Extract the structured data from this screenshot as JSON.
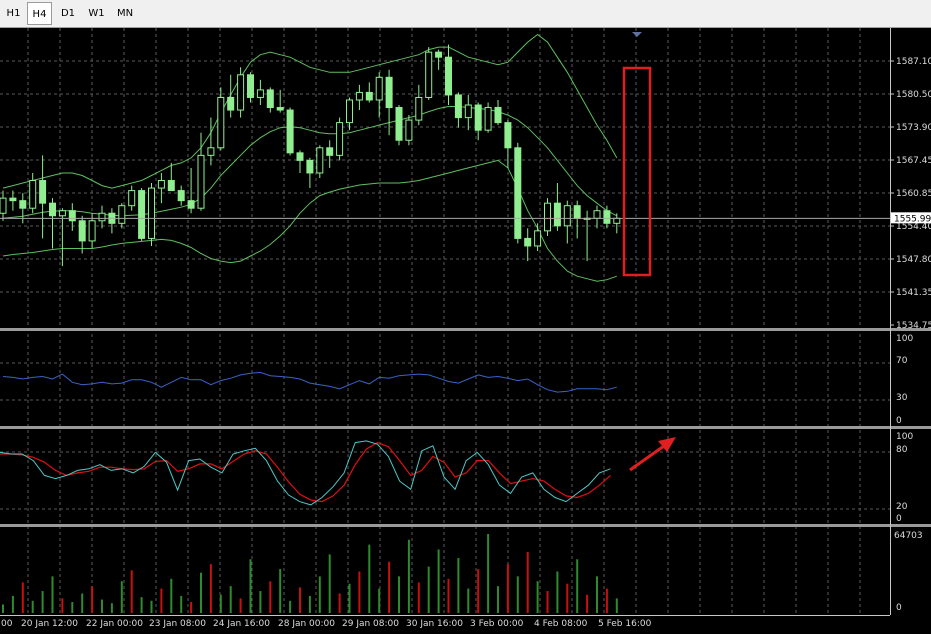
{
  "toolbar": {
    "timeframes": [
      {
        "label": "H1",
        "active": false
      },
      {
        "label": "H4",
        "active": true
      },
      {
        "label": "D1",
        "active": false
      },
      {
        "label": "W1",
        "active": false
      },
      {
        "label": "MN",
        "active": false
      }
    ]
  },
  "colors": {
    "background": "#000000",
    "grid": "#5a5a5a",
    "candle": "#90ee90",
    "bands": "#5fbf5f",
    "rsi": "#3a63c8",
    "stoch_main": "#4fc8c8",
    "stoch_signal": "#e01010",
    "vol_up": "#2e8b2e",
    "vol_down": "#c81010",
    "annotation": "#e02020"
  },
  "price_axis": {
    "labels": [
      "1587.10",
      "1580.50",
      "1573.90",
      "1567.45",
      "1560.85",
      "1554.40",
      "1547.80",
      "1541.35",
      "1534.75"
    ],
    "current_price": "1555.99"
  },
  "rsi_axis": {
    "labels": [
      "100",
      "70",
      "30",
      "0"
    ]
  },
  "stoch_axis": {
    "labels": [
      "100",
      "80",
      "20",
      "0"
    ]
  },
  "volume_axis": {
    "labels": [
      "64703",
      "0"
    ]
  },
  "time_axis": {
    "labels": [
      ":00",
      "20 Jan 12:00",
      "22 Jan 00:00",
      "23 Jan 08:00",
      "24 Jan 16:00",
      "28 Jan 00:00",
      "29 Jan 08:00",
      "30 Jan 16:00",
      "3 Feb 00:00",
      "4 Feb 08:00",
      "5 Feb 16:00"
    ]
  },
  "chart_data": {
    "type": "candlestick",
    "candles": [
      [
        1557.0,
        1561.5,
        1555.5,
        1560.0
      ],
      [
        1560.0,
        1561.5,
        1557.5,
        1559.5
      ],
      [
        1559.5,
        1561.0,
        1555.0,
        1558.0
      ],
      [
        1558.0,
        1565.0,
        1557.0,
        1563.5
      ],
      [
        1563.5,
        1568.5,
        1552.0,
        1559.0
      ],
      [
        1559.0,
        1560.0,
        1550.0,
        1556.5
      ],
      [
        1556.5,
        1558.0,
        1546.5,
        1557.5
      ],
      [
        1557.5,
        1559.0,
        1553.5,
        1555.5
      ],
      [
        1555.5,
        1556.5,
        1549.0,
        1551.5
      ],
      [
        1551.5,
        1557.0,
        1550.0,
        1555.5
      ],
      [
        1555.5,
        1558.5,
        1554.0,
        1557.0
      ],
      [
        1557.0,
        1558.0,
        1553.0,
        1555.0
      ],
      [
        1555.0,
        1559.0,
        1554.0,
        1558.5
      ],
      [
        1558.5,
        1562.5,
        1557.5,
        1561.5
      ],
      [
        1561.5,
        1562.0,
        1551.5,
        1552.0
      ],
      [
        1552.0,
        1563.0,
        1550.5,
        1562.0
      ],
      [
        1562.0,
        1565.0,
        1559.0,
        1563.5
      ],
      [
        1563.5,
        1567.0,
        1561.5,
        1561.5
      ],
      [
        1561.5,
        1562.5,
        1558.5,
        1559.5
      ],
      [
        1559.5,
        1566.0,
        1557.0,
        1558.0
      ],
      [
        1558.0,
        1573.0,
        1557.5,
        1568.5
      ],
      [
        1568.5,
        1576.0,
        1566.5,
        1570.0
      ],
      [
        1570.0,
        1582.0,
        1569.5,
        1580.0
      ],
      [
        1580.0,
        1584.5,
        1576.0,
        1577.5
      ],
      [
        1577.5,
        1586.0,
        1576.0,
        1584.5
      ],
      [
        1584.5,
        1585.0,
        1579.0,
        1580.0
      ],
      [
        1580.0,
        1583.5,
        1578.5,
        1581.5
      ],
      [
        1581.5,
        1582.0,
        1577.0,
        1578.0
      ],
      [
        1578.0,
        1581.5,
        1577.0,
        1577.5
      ],
      [
        1577.5,
        1578.0,
        1568.5,
        1569.0
      ],
      [
        1569.0,
        1569.5,
        1565.0,
        1567.5
      ],
      [
        1567.5,
        1568.0,
        1562.0,
        1565.0
      ],
      [
        1565.0,
        1570.5,
        1564.0,
        1570.0
      ],
      [
        1570.0,
        1571.5,
        1566.0,
        1568.5
      ],
      [
        1568.5,
        1576.0,
        1567.5,
        1575.0
      ],
      [
        1575.0,
        1580.0,
        1573.5,
        1579.5
      ],
      [
        1579.5,
        1582.5,
        1577.5,
        1581.0
      ],
      [
        1581.0,
        1583.0,
        1579.0,
        1579.5
      ],
      [
        1579.5,
        1585.0,
        1576.0,
        1584.0
      ],
      [
        1584.0,
        1585.5,
        1572.5,
        1578.0
      ],
      [
        1578.0,
        1578.5,
        1570.5,
        1571.5
      ],
      [
        1571.5,
        1576.5,
        1570.5,
        1575.5
      ],
      [
        1575.5,
        1582.5,
        1574.5,
        1580.0
      ],
      [
        1580.0,
        1590.0,
        1579.5,
        1589.0
      ],
      [
        1589.0,
        1589.5,
        1585.5,
        1588.0
      ],
      [
        1588.0,
        1590.5,
        1578.5,
        1580.5
      ],
      [
        1580.5,
        1581.0,
        1574.0,
        1576.0
      ],
      [
        1576.0,
        1580.5,
        1573.5,
        1578.5
      ],
      [
        1578.5,
        1579.0,
        1571.5,
        1573.5
      ],
      [
        1573.5,
        1579.0,
        1573.0,
        1578.0
      ],
      [
        1578.0,
        1579.5,
        1574.5,
        1575.0
      ],
      [
        1575.0,
        1575.5,
        1566.0,
        1570.0
      ],
      [
        1570.0,
        1571.0,
        1551.0,
        1552.0
      ],
      [
        1552.0,
        1554.0,
        1547.5,
        1550.5
      ],
      [
        1550.5,
        1555.0,
        1549.5,
        1553.5
      ],
      [
        1553.5,
        1560.0,
        1552.5,
        1559.0
      ],
      [
        1559.0,
        1563.0,
        1553.5,
        1554.5
      ],
      [
        1554.5,
        1559.5,
        1551.0,
        1558.5
      ],
      [
        1558.5,
        1559.5,
        1552.0,
        1556.0
      ],
      [
        1556.0,
        1557.5,
        1547.5,
        1556.0
      ],
      [
        1556.0,
        1558.5,
        1554.0,
        1557.5
      ],
      [
        1557.5,
        1558.5,
        1554.0,
        1555.0
      ],
      [
        1555.0,
        1557.0,
        1553.0,
        1555.99
      ]
    ],
    "bollinger": {
      "upper": [
        1562,
        1562.5,
        1563,
        1563.5,
        1564,
        1564.5,
        1565,
        1565,
        1564.5,
        1563.5,
        1562.5,
        1562,
        1562.5,
        1563,
        1563.5,
        1564.5,
        1565.5,
        1566.5,
        1567,
        1568,
        1570,
        1573,
        1577,
        1580.5,
        1584,
        1587,
        1588.5,
        1589,
        1588.5,
        1588,
        1587,
        1586,
        1585.5,
        1585,
        1585,
        1585,
        1585.5,
        1586,
        1586.5,
        1587,
        1587.5,
        1588,
        1588.5,
        1589.5,
        1590,
        1590,
        1589,
        1588,
        1587.5,
        1587,
        1586.5,
        1587,
        1589,
        1591,
        1592.5,
        1591,
        1588,
        1585,
        1581.5,
        1578,
        1574.5,
        1571.5,
        1568
      ],
      "middle": [
        1556,
        1556.2,
        1556.4,
        1556.8,
        1557.2,
        1557.4,
        1557.5,
        1557.5,
        1557.3,
        1557,
        1556.8,
        1556.6,
        1556.5,
        1556.6,
        1556.7,
        1557,
        1557.4,
        1557.8,
        1558.2,
        1558.8,
        1560,
        1562,
        1564.5,
        1566.5,
        1568.5,
        1570.5,
        1572,
        1573.2,
        1574,
        1574.2,
        1574,
        1573.5,
        1573,
        1572.8,
        1572.8,
        1573,
        1573.5,
        1574,
        1574.5,
        1575,
        1575.5,
        1576,
        1576.5,
        1577.2,
        1577.8,
        1578.2,
        1578.2,
        1578,
        1577.8,
        1577.6,
        1577.2,
        1576.5,
        1575.5,
        1574,
        1572,
        1570,
        1567.5,
        1565,
        1562.5,
        1560.5,
        1559,
        1557.5,
        1556.5
      ],
      "lower": [
        1548.5,
        1548.8,
        1549,
        1549.2,
        1549.5,
        1549.8,
        1550,
        1550,
        1550,
        1550,
        1550.3,
        1550.7,
        1551,
        1551.2,
        1551.4,
        1551.6,
        1551.8,
        1551.6,
        1551,
        1550.2,
        1549,
        1548,
        1547.5,
        1547.2,
        1547.5,
        1548.5,
        1549.5,
        1550.8,
        1552.5,
        1554.5,
        1557,
        1559,
        1560.5,
        1561.2,
        1561.8,
        1562.2,
        1562.6,
        1562.8,
        1563,
        1563,
        1563,
        1563.2,
        1563.5,
        1564,
        1564.5,
        1565,
        1565.5,
        1566,
        1566.5,
        1567,
        1567.5,
        1566,
        1562,
        1557.5,
        1554,
        1550,
        1547.5,
        1545.5,
        1544.5,
        1544,
        1543.5,
        1543.8,
        1544.5
      ]
    },
    "rsi": [
      53,
      52,
      50,
      52,
      53,
      50,
      56,
      46,
      43,
      44,
      46,
      44,
      45,
      49,
      49,
      46,
      40,
      46,
      52,
      49,
      49,
      43,
      48,
      51,
      55,
      57,
      58,
      54,
      53,
      52,
      50,
      45,
      43,
      41,
      38,
      43,
      48,
      44,
      52,
      51,
      54,
      55,
      56,
      55,
      51,
      47,
      45,
      50,
      55,
      52,
      53,
      51,
      48,
      50,
      43,
      37,
      34,
      35,
      38,
      38,
      38,
      37,
      40
    ],
    "stochastic": {
      "main": [
        80,
        78,
        78,
        70,
        52,
        48,
        52,
        58,
        60,
        65,
        58,
        60,
        55,
        63,
        80,
        68,
        34,
        70,
        72,
        62,
        55,
        78,
        82,
        85,
        70,
        45,
        28,
        20,
        16,
        25,
        38,
        55,
        92,
        94,
        90,
        75,
        45,
        35,
        82,
        88,
        50,
        35,
        70,
        80,
        65,
        40,
        30,
        50,
        55,
        35,
        25,
        20,
        30,
        40,
        55,
        60
      ],
      "signal": [
        78,
        78,
        77,
        74,
        68,
        58,
        52,
        55,
        57,
        62,
        62,
        60,
        59,
        60,
        69,
        70,
        57,
        60,
        66,
        66,
        60,
        69,
        78,
        82,
        78,
        62,
        44,
        29,
        22,
        20,
        27,
        40,
        65,
        84,
        92,
        87,
        70,
        52,
        58,
        75,
        68,
        50,
        55,
        70,
        70,
        55,
        42,
        45,
        48,
        45,
        35,
        27,
        25,
        30,
        40,
        52
      ]
    },
    "volume": [
      {
        "v": 7000,
        "up": true
      },
      {
        "v": 14000,
        "up": true
      },
      {
        "v": 25000,
        "up": false
      },
      {
        "v": 10000,
        "up": true
      },
      {
        "v": 18000,
        "up": true
      },
      {
        "v": 30000,
        "up": true
      },
      {
        "v": 12000,
        "up": false
      },
      {
        "v": 9000,
        "up": true
      },
      {
        "v": 16000,
        "up": true
      },
      {
        "v": 22000,
        "up": false
      },
      {
        "v": 11000,
        "up": true
      },
      {
        "v": 8000,
        "up": true
      },
      {
        "v": 26000,
        "up": true
      },
      {
        "v": 35000,
        "up": false
      },
      {
        "v": 13000,
        "up": true
      },
      {
        "v": 10000,
        "up": true
      },
      {
        "v": 20000,
        "up": false
      },
      {
        "v": 28000,
        "up": true
      },
      {
        "v": 14000,
        "up": true
      },
      {
        "v": 9000,
        "up": false
      },
      {
        "v": 33000,
        "up": true
      },
      {
        "v": 40000,
        "up": false
      },
      {
        "v": 15000,
        "up": true
      },
      {
        "v": 22000,
        "up": true
      },
      {
        "v": 12000,
        "up": false
      },
      {
        "v": 44000,
        "up": true
      },
      {
        "v": 18000,
        "up": true
      },
      {
        "v": 26000,
        "up": false
      },
      {
        "v": 36000,
        "up": true
      },
      {
        "v": 10000,
        "up": true
      },
      {
        "v": 21000,
        "up": false
      },
      {
        "v": 14000,
        "up": true
      },
      {
        "v": 30000,
        "up": true
      },
      {
        "v": 48000,
        "up": true
      },
      {
        "v": 16000,
        "up": false
      },
      {
        "v": 24000,
        "up": true
      },
      {
        "v": 34000,
        "up": false
      },
      {
        "v": 56000,
        "up": true
      },
      {
        "v": 20000,
        "up": true
      },
      {
        "v": 42000,
        "up": false
      },
      {
        "v": 30000,
        "up": true
      },
      {
        "v": 60000,
        "up": true
      },
      {
        "v": 25000,
        "up": false
      },
      {
        "v": 38000,
        "up": true
      },
      {
        "v": 52000,
        "up": true
      },
      {
        "v": 28000,
        "up": false
      },
      {
        "v": 45000,
        "up": true
      },
      {
        "v": 20000,
        "up": true
      },
      {
        "v": 36000,
        "up": false
      },
      {
        "v": 64703,
        "up": true
      },
      {
        "v": 22000,
        "up": true
      },
      {
        "v": 40000,
        "up": false
      },
      {
        "v": 30000,
        "up": true
      },
      {
        "v": 50000,
        "up": false
      },
      {
        "v": 26000,
        "up": true
      },
      {
        "v": 18000,
        "up": false
      },
      {
        "v": 34000,
        "up": true
      },
      {
        "v": 24000,
        "up": false
      },
      {
        "v": 44000,
        "up": true
      },
      {
        "v": 15000,
        "up": false
      },
      {
        "v": 30000,
        "up": true
      },
      {
        "v": 20000,
        "up": false
      },
      {
        "v": 12000,
        "up": true
      }
    ]
  }
}
